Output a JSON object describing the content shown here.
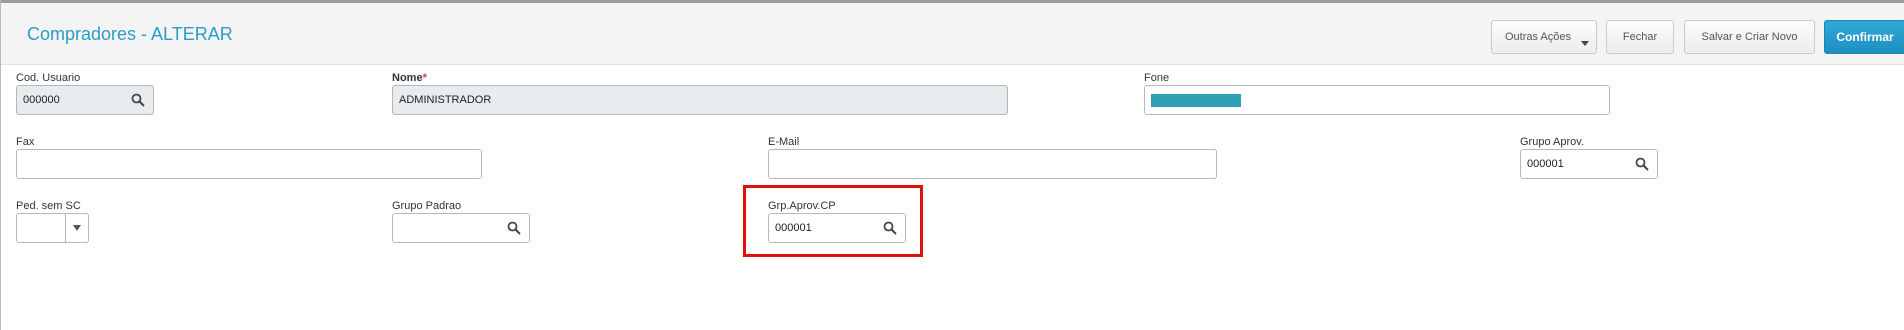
{
  "header": {
    "title": "Compradores - ALTERAR",
    "buttons": {
      "outras_acoes": "Outras Ações",
      "fechar": "Fechar",
      "salvar_criar_novo": "Salvar e Criar Novo",
      "confirmar": "Confirmar"
    }
  },
  "form": {
    "cod_usuario": {
      "label": "Cod. Usuario",
      "value": "000000",
      "icon": "search-icon"
    },
    "nome": {
      "label": "Nome",
      "required_mark": "*",
      "value": "ADMINISTRADOR"
    },
    "fone": {
      "label": "Fone",
      "value_masked": true
    },
    "fax": {
      "label": "Fax",
      "value": ""
    },
    "email": {
      "label": "E-Mail",
      "value": ""
    },
    "grupo_aprov": {
      "label": "Grupo Aprov.",
      "value": "000001",
      "icon": "search-icon"
    },
    "ped_sem_sc": {
      "label": "Ped. sem SC",
      "value": ""
    },
    "grupo_padrao": {
      "label": "Grupo Padrao",
      "value": "",
      "icon": "search-icon"
    },
    "grp_aprov_cp": {
      "label": "Grp.Aprov.CP",
      "value": "000001",
      "icon": "search-icon"
    }
  },
  "colors": {
    "title": "#2a9cc8",
    "primary_button": "#1e8fc0",
    "highlight_box": "#e01010",
    "masked_value": "#2e9fb5"
  }
}
